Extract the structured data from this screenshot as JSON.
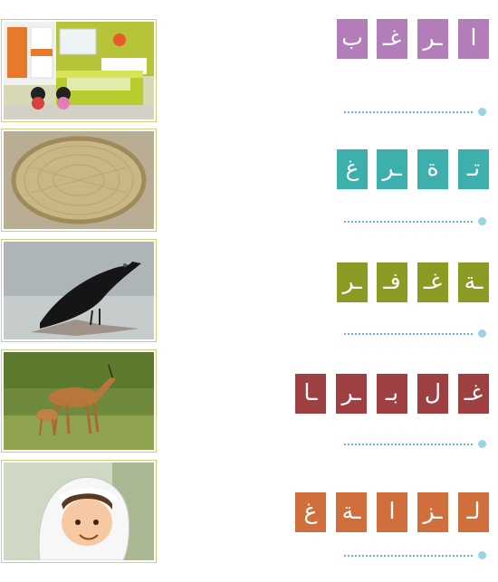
{
  "rows": [
    {
      "tiles": [
        "ا",
        "ـر",
        "غـ",
        "ب"
      ],
      "color": "#b27db8",
      "image": "colorful-bedroom"
    },
    {
      "tiles": [
        "تـ",
        "ة",
        "ـر",
        "غ"
      ],
      "color": "#3db0ad",
      "image": "woven-straw-tray"
    },
    {
      "tiles": [
        "ـة",
        "غـ",
        "فـ",
        "ـر"
      ],
      "color": "#8a9a22",
      "image": "black-crow-on-branch"
    },
    {
      "tiles": [
        "غـ",
        "ل",
        "بـ",
        "ـر",
        "ـا"
      ],
      "color": "#9e3f42",
      "image": "gazelle-with-fawn"
    },
    {
      "tiles": [
        "لـ",
        "ـز",
        "ا",
        "ـة",
        "غ"
      ],
      "color": "#d06f3c",
      "image": "boy-in-ghutra"
    }
  ],
  "colors": {
    "frame_border": "#c9d27a",
    "dots": "#5fb9d6"
  }
}
